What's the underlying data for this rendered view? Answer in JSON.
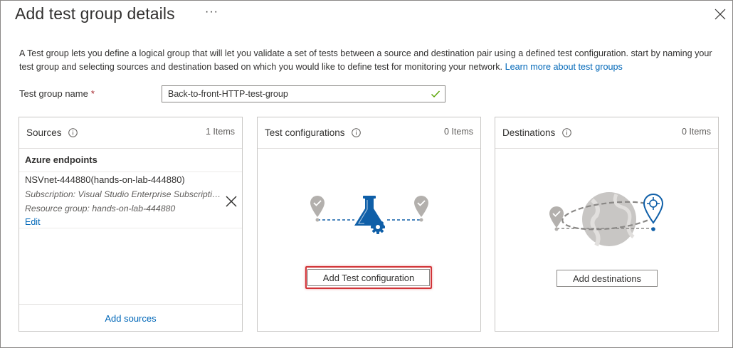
{
  "header": {
    "title": "Add test group details",
    "more_label": "···",
    "close_icon": "close-icon"
  },
  "description": {
    "text": "A Test group lets you define a logical group that will let you validate a set of tests between a source and destination pair using a defined test configuration. start by naming your test group and selecting sources and destination based on which you would like to define test for monitoring your network.",
    "link": "Learn more about test groups"
  },
  "form": {
    "name_label": "Test group name",
    "required_marker": "*",
    "name_value": "Back-to-front-HTTP-test-group",
    "valid_icon": "checkmark-icon"
  },
  "sources": {
    "title": "Sources",
    "count": "1 Items",
    "group_title": "Azure endpoints",
    "endpoint": {
      "name": "NSVnet-444880(hands-on-lab-444880)",
      "subscription": "Subscription: Visual Studio Enterprise Subscription",
      "resource_group": "Resource group: hands-on-lab-444880",
      "edit_label": "Edit"
    },
    "add_label": "Add sources"
  },
  "test_configurations": {
    "title": "Test configurations",
    "count": "0 Items",
    "add_label": "Add Test configuration"
  },
  "destinations": {
    "title": "Destinations",
    "count": "0 Items",
    "add_label": "Add destinations"
  },
  "colors": {
    "accent": "#0067b8",
    "icon_blue": "#0f5fa8",
    "gray": "#b3b0ad",
    "highlight": "#d13438",
    "valid_green": "#57a300"
  }
}
